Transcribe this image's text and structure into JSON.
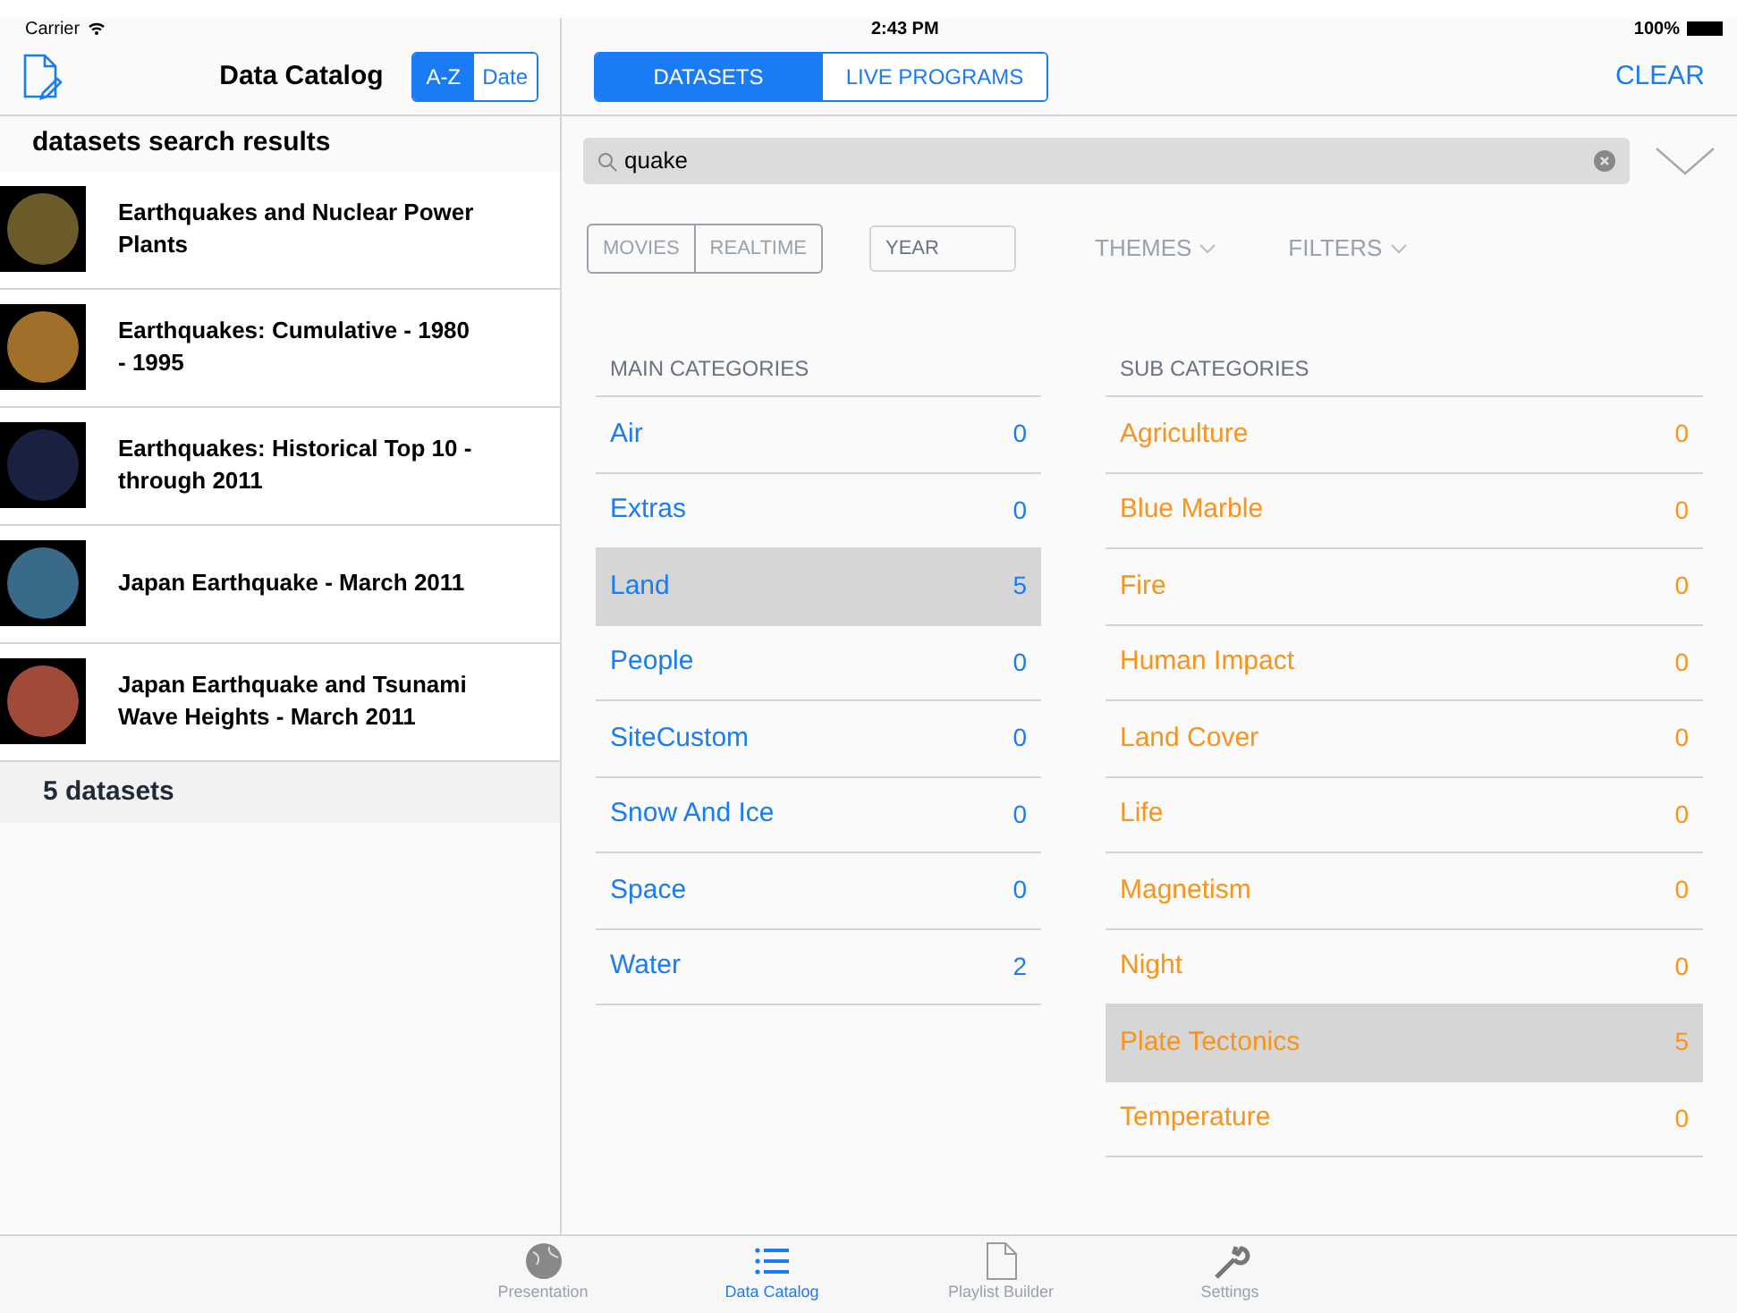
{
  "status_bar": {
    "carrier": "Carrier",
    "time": "2:43 PM",
    "battery": "100%"
  },
  "sidebar": {
    "title": "Data Catalog",
    "sort_options": [
      {
        "label": "A-Z",
        "selected": true
      },
      {
        "label": "Date",
        "selected": false
      }
    ],
    "heading": "datasets search results",
    "results": [
      {
        "title": "Earthquakes and Nuclear Power Plants"
      },
      {
        "title": "Earthquakes: Cumulative - 1980 - 1995"
      },
      {
        "title": "Earthquakes: Historical Top 10 - through 2011"
      },
      {
        "title": "Japan Earthquake - March 2011"
      },
      {
        "title": "Japan Earthquake and Tsunami Wave Heights - March 2011"
      }
    ],
    "count": "5 datasets"
  },
  "segments": [
    {
      "label": "DATASETS",
      "selected": true
    },
    {
      "label": "LIVE PROGRAMS",
      "selected": false
    }
  ],
  "clear": "CLEAR",
  "search": {
    "value": "quake"
  },
  "type_filters": [
    "MOVIES",
    "REALTIME"
  ],
  "year": {
    "placeholder": "YEAR"
  },
  "dropdowns": [
    "THEMES",
    "FILTERS"
  ],
  "main_categories": {
    "heading": "MAIN CATEGORIES",
    "items": [
      {
        "label": "Air",
        "count": "0",
        "selected": false
      },
      {
        "label": "Extras",
        "count": "0",
        "selected": false
      },
      {
        "label": "Land",
        "count": "5",
        "selected": true
      },
      {
        "label": "People",
        "count": "0",
        "selected": false
      },
      {
        "label": "SiteCustom",
        "count": "0",
        "selected": false
      },
      {
        "label": "Snow And Ice",
        "count": "0",
        "selected": false
      },
      {
        "label": "Space",
        "count": "0",
        "selected": false
      },
      {
        "label": "Water",
        "count": "2",
        "selected": false
      }
    ]
  },
  "sub_categories": {
    "heading": "SUB CATEGORIES",
    "items": [
      {
        "label": "Agriculture",
        "count": "0",
        "selected": false
      },
      {
        "label": "Blue Marble",
        "count": "0",
        "selected": false
      },
      {
        "label": "Fire",
        "count": "0",
        "selected": false
      },
      {
        "label": "Human Impact",
        "count": "0",
        "selected": false
      },
      {
        "label": "Land Cover",
        "count": "0",
        "selected": false
      },
      {
        "label": "Life",
        "count": "0",
        "selected": false
      },
      {
        "label": "Magnetism",
        "count": "0",
        "selected": false
      },
      {
        "label": "Night",
        "count": "0",
        "selected": false
      },
      {
        "label": "Plate Tectonics",
        "count": "5",
        "selected": true
      },
      {
        "label": "Temperature",
        "count": "0",
        "selected": false
      }
    ]
  },
  "tab_bar": [
    {
      "label": "Presentation",
      "selected": false
    },
    {
      "label": "Data Catalog",
      "selected": true
    },
    {
      "label": "Playlist Builder",
      "selected": false
    },
    {
      "label": "Settings",
      "selected": false
    }
  ]
}
